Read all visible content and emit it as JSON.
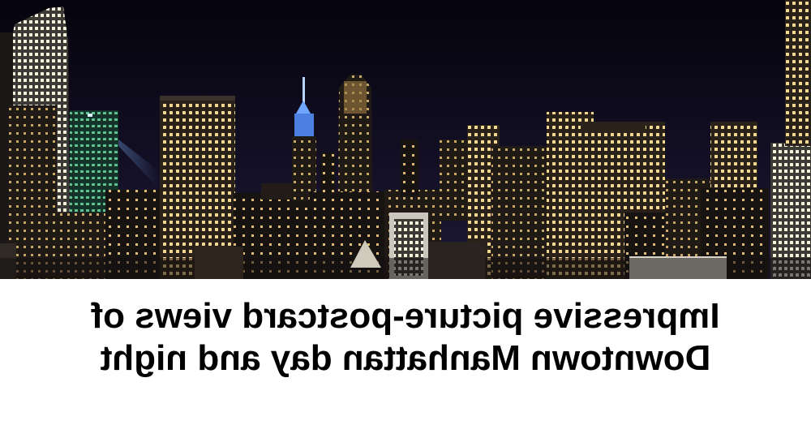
{
  "image": {
    "subject": "skyline-night-mirrored",
    "colors": {
      "sky_top": "#05040d",
      "sky_bottom": "#1d1838",
      "window_light": "#f3d690",
      "spire_blue": "#6fa4ff",
      "glass_green": "#5fbf8e"
    }
  },
  "caption": {
    "line1": "Impressive picture-postcard views of",
    "line2": "Downtown Manhattan day and night"
  }
}
